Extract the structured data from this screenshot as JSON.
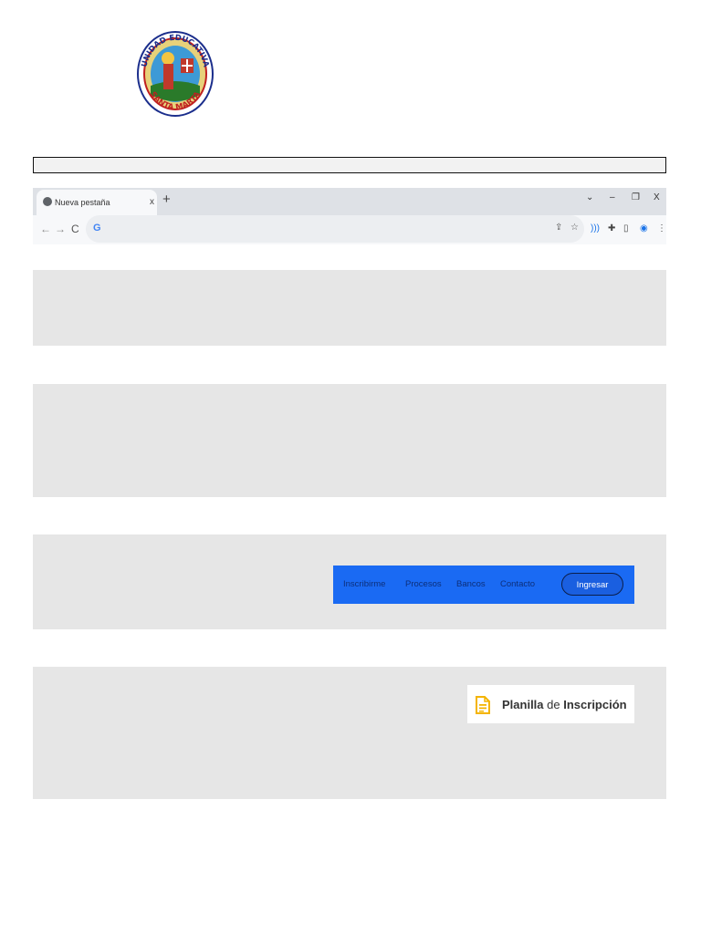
{
  "logo": {
    "text_top": "UNIDAD EDUCATIVA",
    "text_bottom": "SANTA MARTA"
  },
  "browser": {
    "tab_title": "Nueva pestaña",
    "tab_close": "x",
    "new_tab": "+",
    "window_controls": {
      "dropdown": "⌄",
      "minimize": "–",
      "restore": "❐",
      "close": "X"
    },
    "nav": {
      "back": "←",
      "forward": "→",
      "reload": "C"
    },
    "omnibox_logo": "G",
    "icons": [
      "share-icon",
      "star-icon",
      "audio-icon",
      "extensions-icon",
      "sidebar-icon",
      "profile-icon",
      "menu-icon"
    ]
  },
  "site_nav": {
    "links": [
      "Inscribirme",
      "Procesos",
      "Bancos",
      "Contacto"
    ],
    "login_button": "Ingresar",
    "colors": {
      "bar": "#1a6af3",
      "link": "#0d2f7a"
    }
  },
  "registration": {
    "label_bold_1": "Planilla",
    "label_regular": "de",
    "label_bold_2": "Inscripción",
    "icon": "document-icon",
    "icon_color": "#f4b400"
  }
}
